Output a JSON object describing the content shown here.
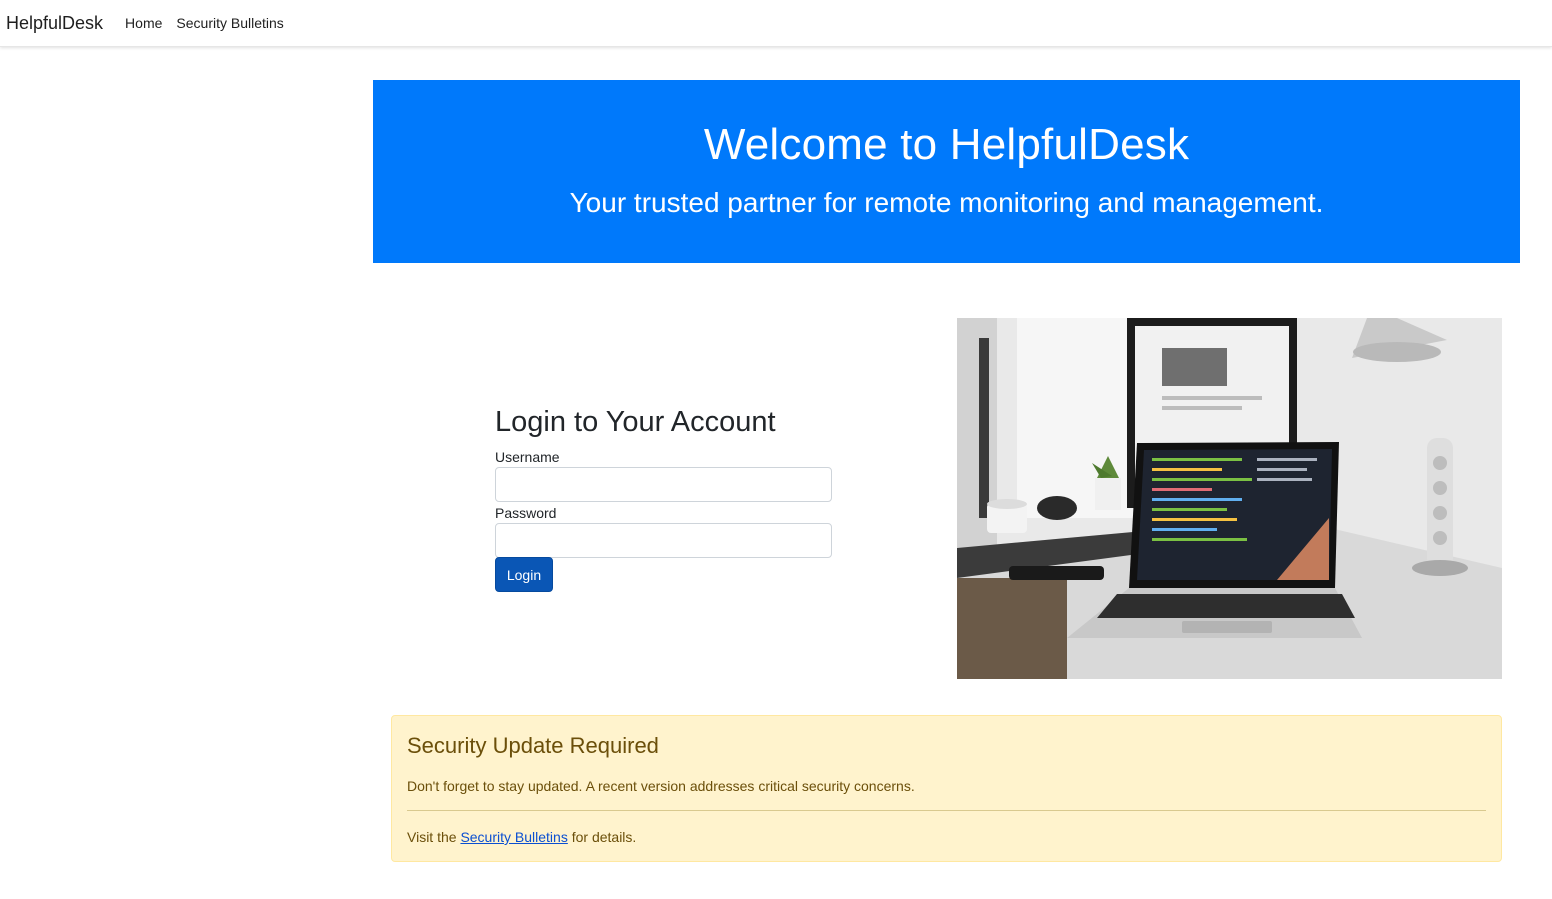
{
  "navbar": {
    "brand": "HelpfulDesk",
    "links": [
      "Home",
      "Security Bulletins"
    ]
  },
  "hero": {
    "title": "Welcome to HelpfulDesk",
    "subtitle": "Your trusted partner for remote monitoring and management."
  },
  "login": {
    "title": "Login to Your Account",
    "username_label": "Username",
    "username_value": "",
    "password_label": "Password",
    "password_value": "",
    "button_label": "Login"
  },
  "alert": {
    "heading": "Security Update Required",
    "text": "Don't forget to stay updated. A recent version addresses critical security concerns.",
    "footer_prefix": "Visit the ",
    "footer_link": "Security Bulletins",
    "footer_suffix": " for details."
  },
  "colors": {
    "hero_bg": "#0079fb",
    "button_bg": "#0a56b5",
    "alert_bg": "#fff3cd",
    "link": "#0b4fd1"
  }
}
